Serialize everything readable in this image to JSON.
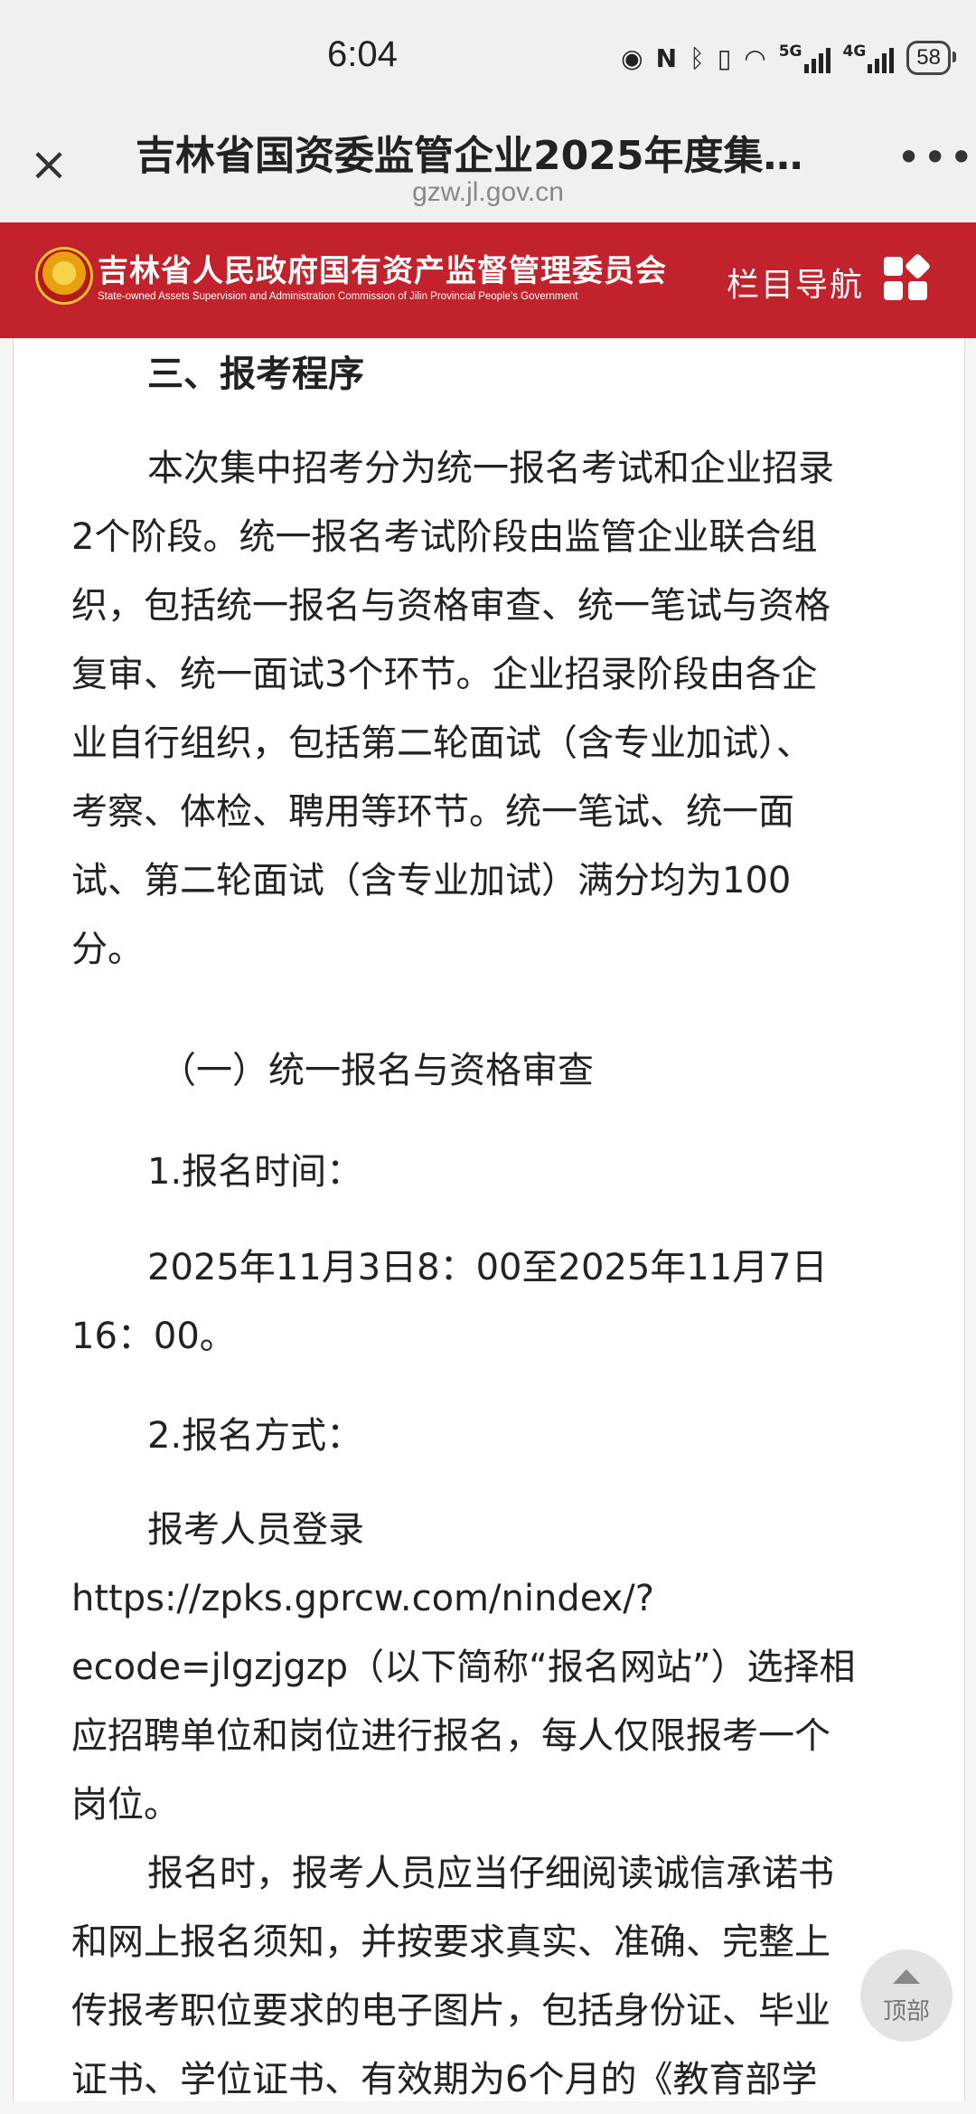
{
  "status_bar": {
    "time": "6:04",
    "icons": [
      "eye-icon",
      "nfc-icon",
      "bluetooth-icon",
      "vibrate-icon",
      "wifi-icon",
      "signal-5g-icon",
      "signal-4g-icon"
    ],
    "net_1": "5G",
    "net_2": "4G",
    "battery": "58"
  },
  "browser": {
    "title": "吉林省国资委监管企业2025年度集…",
    "url": "gzw.jl.gov.cn",
    "close_icon": "×",
    "more_icon": "•••"
  },
  "banner": {
    "site_name_cn": "吉林省人民政府国有资产监督管理委员会",
    "site_name_en": "State-owned Assets Supervision and Administration Commission of Jilin Provincial People's Government",
    "nav_label": "栏目导航",
    "colors": {
      "background": "#c1222b",
      "text": "#ffffff"
    }
  },
  "article": {
    "section_heading": "三、报考程序",
    "para1": [
      "本次集中招考分为统一报名考试和企业招录",
      "2个阶段。统一报名考试阶段由监管企业联合组",
      "织，包括统一报名与资格审查、统一笔试与资格",
      "复审、统一面试3个环节。企业招录阶段由各企",
      "业自行组织，包括第二轮面试（含专业加试）、",
      "考察、体检、聘用等环节。统一笔试、统一面",
      "试、第二轮面试（含专业加试）满分均为100",
      "分。"
    ],
    "subheading": "（一）统一报名与资格审查",
    "item1_title": "1.报名时间：",
    "item1_lines": [
      "2025年11月3日8：00至2025年11月7日",
      "16：00。"
    ],
    "item2_title": "2.报名方式：",
    "item2_lines": [
      "报考人员登录",
      "https://zpks.gprcw.com/nindex/?",
      "ecode=jlgzjgzp（以下简称“报名网站”）选择相",
      "应招聘单位和岗位进行报名，每人仅限报考一个",
      "岗位。"
    ],
    "para_last": [
      "报名时，报考人员应当仔细阅读诚信承诺书",
      "和网上报名须知，并按要求真实、准确、完整上",
      "传报考职位要求的电子图片，包括身份证、毕业",
      "证书、学位证书、有效期为6个月的《教育部学"
    ]
  },
  "back_to_top": {
    "label": "顶部"
  }
}
